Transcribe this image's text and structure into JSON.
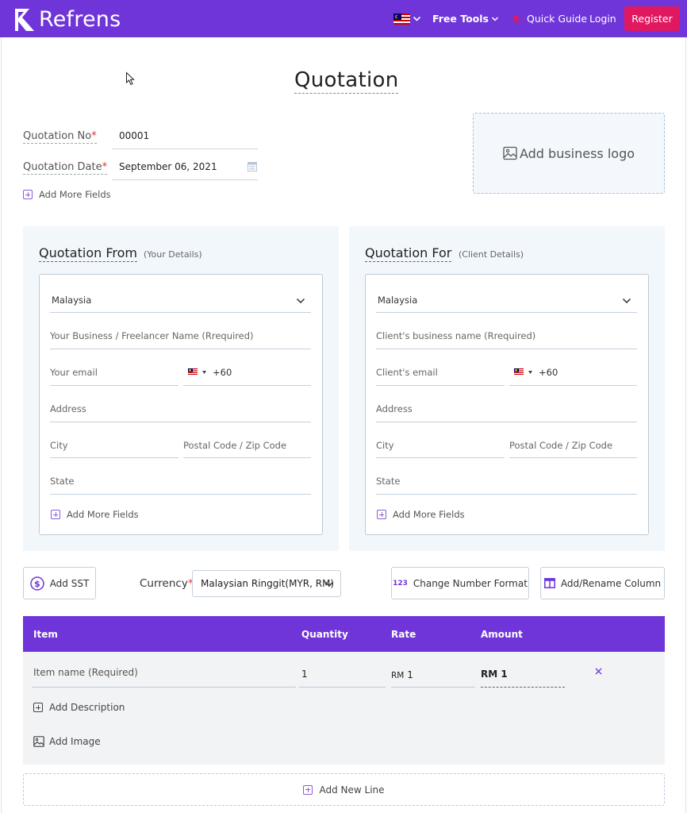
{
  "header": {
    "brand": "Refrens",
    "flag_icon": "malaysia-flag-icon",
    "free_tools_label": "Free Tools",
    "quick_guide_label": "Quick Guide",
    "login_label": "Login",
    "register_label": "Register",
    "accent_color": "#6f35d8",
    "register_color": "#e0185f"
  },
  "document": {
    "title": "Quotation",
    "quotation_no_label": "Quotation No",
    "quotation_no_value": "00001",
    "quotation_date_label": "Quotation Date",
    "quotation_date_value": "September 06, 2021",
    "required_mark": "*",
    "add_more_fields_label": "Add More Fields",
    "add_logo_label": "Add business logo"
  },
  "from": {
    "title": "Quotation From",
    "subtitle": "(Your Details)",
    "country": "Malaysia",
    "name_placeholder": "Your Business / Freelancer Name (Rrequired)",
    "email_placeholder": "Your email",
    "phone_code": "+60",
    "address_placeholder": "Address",
    "city_placeholder": "City",
    "postal_placeholder": "Postal Code / Zip Code",
    "state_placeholder": "State",
    "add_more_label": "Add More Fields"
  },
  "for": {
    "title": "Quotation For",
    "subtitle": "(Client Details)",
    "country": "Malaysia",
    "name_placeholder": "Client's business name (Rrequired)",
    "email_placeholder": "Client's email",
    "phone_code": "+60",
    "address_placeholder": "Address",
    "city_placeholder": "City",
    "postal_placeholder": "Postal Code / Zip Code",
    "state_placeholder": "State",
    "add_more_label": "Add More Fields"
  },
  "toolbar": {
    "add_tax_label": "Add SST",
    "currency_label": "Currency",
    "currency_value": "Malaysian Ringgit(MYR, RM)",
    "number_format_icon_text": "123",
    "number_format_label": "Change Number Format",
    "add_column_label": "Add/Rename Column"
  },
  "items": {
    "columns": [
      "Item",
      "Quantity",
      "Rate",
      "Amount"
    ],
    "row": {
      "name_placeholder": "Item name (Required)",
      "quantity": "1",
      "rate_currency": "RM",
      "rate": "1",
      "amount": "RM 1"
    },
    "add_description_label": "Add Description",
    "add_image_label": "Add Image",
    "add_line_label": "Add New Line"
  }
}
